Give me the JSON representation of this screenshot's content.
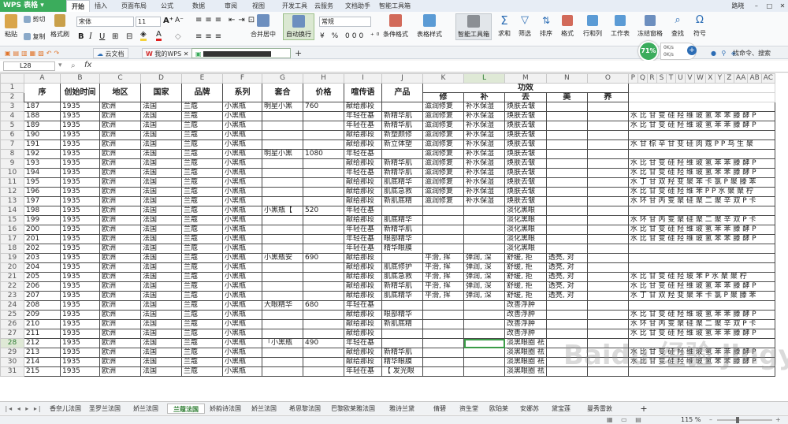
{
  "app": {
    "name": "WPS 表格",
    "user": "路晓",
    "accent": "#3bac5c"
  },
  "ribbon_tabs": [
    "开始",
    "插入",
    "页面布局",
    "公式",
    "数据",
    "审阅",
    "视图",
    "开发工具",
    "云服务",
    "文档助手",
    "智能工具箱"
  ],
  "window_controls": [
    "–",
    "□",
    "✕"
  ],
  "toolbar": {
    "paste": "粘贴",
    "cut": "剪切",
    "copy": "复制",
    "format_painter": "格式刷",
    "font_name": "宋体",
    "font_size": "11",
    "merge_center": "合并居中",
    "wrap": "自动换行",
    "number_format": "常规",
    "cond_format": "条件格式",
    "table_style": "表格样式",
    "smart_tools": "智能工具箱",
    "sum": "求和",
    "filter": "筛选",
    "sort": "排序",
    "format": "格式",
    "rows_cols": "行和列",
    "worksheet": "工作表",
    "freeze": "冻结窗格",
    "find": "查找",
    "symbol": "符号",
    "search_hint": "找命令、搜索"
  },
  "doc_tabs": {
    "cloud": "云文档",
    "mywps": "我的WPS"
  },
  "perf": {
    "percent": "71%",
    "up": "0K/s",
    "down": "0K/s"
  },
  "formula_bar": {
    "cell_ref": "L28",
    "fx": "fx",
    "value": ""
  },
  "columns": [
    "A",
    "B",
    "C",
    "D",
    "E",
    "F",
    "G",
    "H",
    "I",
    "J",
    "K",
    "L",
    "M",
    "N",
    "O",
    "P",
    "Q",
    "R",
    "S",
    "T",
    "U",
    "V",
    "W",
    "X",
    "Y",
    "Z",
    "AA",
    "AB",
    "AC"
  ],
  "row_numbers": [
    1,
    2,
    3,
    4,
    5,
    6,
    7,
    8,
    9,
    10,
    11,
    12,
    13,
    14,
    15,
    16,
    17,
    18,
    19,
    20,
    21,
    22,
    23,
    24,
    25,
    26,
    27,
    28,
    29,
    30,
    31
  ],
  "headers": {
    "seq": "序",
    "year": "创始时间",
    "region": "地区",
    "country": "国家",
    "brand": "品牌",
    "series": "系列",
    "set": "套合",
    "price": "价格",
    "slogan": "喧传语",
    "product": "产品",
    "effect": "功效",
    "repair": "修",
    "supplement": "补",
    "remove": "去",
    "beauty": "美",
    "nourish": "养"
  },
  "rows": [
    [
      "187",
      "1935",
      "欧洲",
      "法国",
      "兰蔻",
      "小黑瓶",
      "明星小黑",
      "760",
      "献给那段",
      "",
      "滋润修复",
      "补水保湿",
      "焕肤去皱",
      "",
      "",
      ""
    ],
    [
      "188",
      "1935",
      "欧洲",
      "法国",
      "兰蔻",
      "小黑瓶",
      "",
      "",
      "年轻在基",
      "新精华肌",
      "滋润修复",
      "补水保湿",
      "焕肤去皱",
      "",
      "",
      "水 比 甘 变 硅 羟 维 玻 氢 苯 苯 滕 酵 P"
    ],
    [
      "189",
      "1935",
      "欧洲",
      "法国",
      "兰蔻",
      "小黑瓶",
      "",
      "",
      "年轻在基",
      "新精华肌",
      "滋润修复",
      "补水保湿",
      "焕肤去皱",
      "",
      "",
      "水 比 甘 变 硅 羟 维 玻 氢 苯 苯 滕 酵 P"
    ],
    [
      "190",
      "1935",
      "欧洲",
      "法国",
      "兰蔻",
      "小黑瓶",
      "",
      "",
      "献给那段",
      "新塑颜修",
      "滋润修复",
      "补水保湿",
      "焕肤去皱",
      "",
      "",
      ""
    ],
    [
      "191",
      "1935",
      "欧洲",
      "法国",
      "兰蔻",
      "小黑瓶",
      "",
      "",
      "献给那段",
      "新立体塑",
      "滋润修复",
      "补水保湿",
      "焕肤去皱",
      "",
      "",
      "水 甘 棕 辛 甘 变 硅 肉 蔻 P  P  鸟 生 聚"
    ],
    [
      "192",
      "1935",
      "欧洲",
      "法国",
      "兰蔻",
      "小黑瓶",
      "明星小黑",
      "1080",
      "年轻在基",
      "",
      "滋润修复",
      "补水保湿",
      "焕肤去皱",
      "",
      "",
      ""
    ],
    [
      "193",
      "1935",
      "欧洲",
      "法国",
      "兰蔻",
      "小黑瓶",
      "",
      "",
      "献给那段",
      "新精华肌",
      "滋润修复",
      "补水保湿",
      "焕肤去皱",
      "",
      "",
      "水 比 甘 变 硅 羟 维 玻 氢 苯 苯 滕 酵 P"
    ],
    [
      "194",
      "1935",
      "欧洲",
      "法国",
      "兰蔻",
      "小黑瓶",
      "",
      "",
      "年轻在基",
      "新精华肌",
      "滋润修复",
      "补水保湿",
      "焕肤去皱",
      "",
      "",
      "水 比 甘 变 硅 羟 维 玻 氢 苯 苯 滕 酵 P"
    ],
    [
      "195",
      "1935",
      "欧洲",
      "法国",
      "兰蔻",
      "小黑瓶",
      "",
      "",
      "献给那段",
      "肌底精华",
      "滋润修复",
      "补水保湿",
      "焕肤去皱",
      "",
      "",
      "水 丁 甘 双 羟 变 聚 苯 卡 氯 P  聚 滕 苯"
    ],
    [
      "196",
      "1935",
      "欧洲",
      "法国",
      "兰蔻",
      "小黑瓶",
      "",
      "",
      "献给那段",
      "肌底急救",
      "滋润修复",
      "补水保湿",
      "焕肤去皱",
      "",
      "",
      "水 比 甘 变 硅 羟 维 苯 P  P  水 聚 聚 柠"
    ],
    [
      "197",
      "1935",
      "欧洲",
      "法国",
      "兰蔻",
      "小黑瓶",
      "",
      "",
      "献给那段",
      "新肌底精",
      "滋润修复",
      "补水保湿",
      "焕肤去皱",
      "",
      "",
      "水 环 甘 丙 变 聚 硅 聚 二 聚 辛 双 P  卡"
    ],
    [
      "198",
      "1935",
      "欧洲",
      "法国",
      "兰蔻",
      "小黑瓶",
      "小黑瓶【",
      "520",
      "年轻在基",
      "",
      "",
      "",
      "淡化黑眼",
      "",
      "",
      ""
    ],
    [
      "199",
      "1935",
      "欧洲",
      "法国",
      "兰蔻",
      "小黑瓶",
      "",
      "",
      "献给那段",
      "肌底精华",
      "",
      "",
      "淡化黑眼",
      "",
      "",
      "水 环 甘 丙 变 聚 硅 聚 二 聚 辛 双 P  卡"
    ],
    [
      "200",
      "1935",
      "欧洲",
      "法国",
      "兰蔻",
      "小黑瓶",
      "",
      "",
      "年轻在基",
      "新精华肌",
      "",
      "",
      "淡化黑眼",
      "",
      "",
      "水 比 甘 变 硅 羟 维 玻 氢 苯 苯 滕 酵 P"
    ],
    [
      "201",
      "1935",
      "欧洲",
      "法国",
      "兰蔻",
      "小黑瓶",
      "",
      "",
      "年轻在基",
      "眼部精华",
      "",
      "",
      "淡化黑眼",
      "",
      "",
      "水 比 甘 变 硅 羟 维 玻 氢 苯 苯 滕 酵 P"
    ],
    [
      "202",
      "1935",
      "欧洲",
      "法国",
      "兰蔻",
      "小黑瓶",
      "",
      "",
      "年轻在基",
      "精华眼膜",
      "",
      "",
      "淡化黑眼",
      "",
      "",
      ""
    ],
    [
      "203",
      "1935",
      "欧洲",
      "法国",
      "兰蔻",
      "小黑瓶",
      "小黑瓶安",
      "690",
      "献给那段",
      "",
      "平滑, 挥",
      "弹润, 深",
      "舒缓, 拒",
      "透亮, 对",
      "",
      ""
    ],
    [
      "204",
      "1935",
      "欧洲",
      "法国",
      "兰蔻",
      "小黑瓶",
      "",
      "",
      "献给那段",
      "肌底修护",
      "平滑, 挥",
      "弹润, 深",
      "舒缓, 拒",
      "透亮, 对",
      "",
      ""
    ],
    [
      "205",
      "1935",
      "欧洲",
      "法国",
      "兰蔻",
      "小黑瓶",
      "",
      "",
      "献给那段",
      "肌底急救",
      "平滑, 挥",
      "弹润, 深",
      "舒缓, 拒",
      "透亮, 对",
      "",
      "水 比 甘 变 硅 羟 玻 苯 P  水 聚 聚 柠"
    ],
    [
      "206",
      "1935",
      "欧洲",
      "法国",
      "兰蔻",
      "小黑瓶",
      "",
      "",
      "献给那段",
      "新精华肌",
      "平滑, 挥",
      "弹润, 深",
      "舒缓, 拒",
      "透亮, 对",
      "",
      "水 比 甘 变 硅 羟 维 玻 氢 苯 苯 滕 酵 P"
    ],
    [
      "207",
      "1935",
      "欧洲",
      "法国",
      "兰蔻",
      "小黑瓶",
      "",
      "",
      "献给那段",
      "肌底精华",
      "平滑, 挥",
      "弹润, 深",
      "舒缓, 拒",
      "透亮, 对",
      "",
      "水 丁 甘 双 羟 变 聚 苯 卡 氯 P  聚 滕 苯"
    ],
    [
      "208",
      "1935",
      "欧洲",
      "法国",
      "兰蔻",
      "小黑瓶",
      "大眼精华",
      "680",
      "年轻在基",
      "",
      "",
      "",
      "改善浮肿",
      "",
      "",
      ""
    ],
    [
      "209",
      "1935",
      "欧洲",
      "法国",
      "兰蔻",
      "小黑瓶",
      "",
      "",
      "献给那段",
      "眼部精华",
      "",
      "",
      "改善浮肿",
      "",
      "",
      "水 比 甘 变 硅 羟 维 玻 氢 苯 苯 滕 酵 P"
    ],
    [
      "210",
      "1935",
      "欧洲",
      "法国",
      "兰蔻",
      "小黑瓶",
      "",
      "",
      "献给那段",
      "新肌底精",
      "",
      "",
      "改善浮肿",
      "",
      "",
      "水 环 甘 丙 变 聚 硅 聚 二 聚 辛 双 P  卡"
    ],
    [
      "211",
      "1935",
      "欧洲",
      "法国",
      "兰蔻",
      "小黑瓶",
      "",
      "",
      "献给那段",
      "",
      "",
      "",
      "改善浮肿",
      "",
      "",
      "水 比 甘 变 硅 羟 维 玻 氢 苯 苯 滕 酵 P"
    ],
    [
      "212",
      "1935",
      "欧洲",
      "法国",
      "兰蔻",
      "小黑瓶",
      "「小黑瓶",
      "490",
      "年轻在基",
      "",
      "",
      "",
      "淡黑眼圈 祛",
      "",
      "",
      ""
    ],
    [
      "213",
      "1935",
      "欧洲",
      "法国",
      "兰蔻",
      "小黑瓶",
      "",
      "",
      "献给那段",
      "新精华肌",
      "",
      "",
      "淡黑眼圈 祛",
      "",
      "",
      "水 比 甘 变 硅 羟 维 玻 氢 苯 苯 滕 酵 P"
    ],
    [
      "214",
      "1935",
      "欧洲",
      "法国",
      "兰蔻",
      "小黑瓶",
      "",
      "",
      "献给那段",
      "精华眼膜",
      "",
      "",
      "淡黑眼圈 祛",
      "",
      "",
      "水 比 甘 变 硅 羟 维 玻 氢 苯 苯 滕 酵 P"
    ],
    [
      "215",
      "1935",
      "欧洲",
      "法国",
      "兰蔻",
      "小黑瓶",
      "",
      "",
      "年轻在基",
      "【 发光眼",
      "",
      "",
      "淡黑眼圈 祛",
      "",
      "",
      ""
    ]
  ],
  "sheet_tabs": [
    "香奈儿法国",
    "圣罗兰法国",
    "娇兰法国",
    "兰蔻法国",
    "娇韵诗法国",
    "娇兰法国",
    "希思黎法国",
    "巴黎欧莱雅法国",
    "雅诗兰黛",
    "倩碧",
    "资生堂",
    "欧珀莱",
    "安娜苏",
    "黛宝莲",
    "曼秀雷敦"
  ],
  "active_sheet": 3,
  "zoom": "115 %",
  "watermark": "Baidu 经验 jingyan.baidu.com"
}
